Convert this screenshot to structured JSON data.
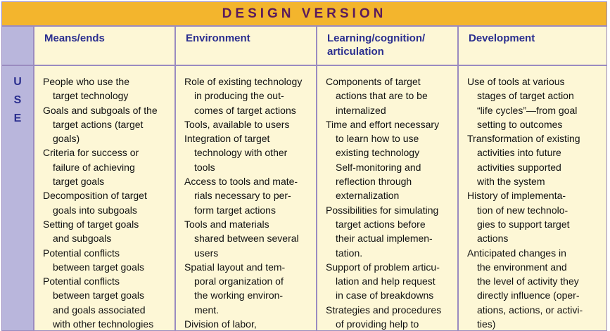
{
  "title": "DESIGN VERSION",
  "side_label": [
    "U",
    "S",
    "E"
  ],
  "columns": [
    {
      "heading": [
        "Means/ends"
      ],
      "lines": [
        {
          "text": "People who use the",
          "indent": false
        },
        {
          "text": "target technology",
          "indent": true
        },
        {
          "text": "Goals and subgoals of the",
          "indent": false
        },
        {
          "text": "target actions (target",
          "indent": true
        },
        {
          "text": "goals)",
          "indent": true
        },
        {
          "text": "Criteria for success or",
          "indent": false
        },
        {
          "text": "failure of achieving",
          "indent": true
        },
        {
          "text": "target goals",
          "indent": true
        },
        {
          "text": "Decomposition of target",
          "indent": false
        },
        {
          "text": "goals into subgoals",
          "indent": true
        },
        {
          "text": "Setting of target goals",
          "indent": false
        },
        {
          "text": "and subgoals",
          "indent": true
        },
        {
          "text": "Potential conflicts",
          "indent": false
        },
        {
          "text": "between target goals",
          "indent": true
        },
        {
          "text": "Potential conflicts",
          "indent": false
        },
        {
          "text": "between target goals",
          "indent": true
        },
        {
          "text": "and goals associated",
          "indent": true
        },
        {
          "text": "with other technologies",
          "indent": true
        }
      ]
    },
    {
      "heading": [
        "Environment"
      ],
      "lines": [
        {
          "text": "Role of existing technology",
          "indent": false
        },
        {
          "text": "in producing the out-",
          "indent": true
        },
        {
          "text": "comes of target actions",
          "indent": true
        },
        {
          "text": "Tools, available to users",
          "indent": false
        },
        {
          "text": "Integration of target",
          "indent": false
        },
        {
          "text": "technology with other",
          "indent": true
        },
        {
          "text": "tools",
          "indent": true
        },
        {
          "text": "Access to tools and mate-",
          "indent": false
        },
        {
          "text": "rials necessary to per-",
          "indent": true
        },
        {
          "text": "form target actions",
          "indent": true
        },
        {
          "text": "Tools and materials",
          "indent": false
        },
        {
          "text": "shared between several",
          "indent": true
        },
        {
          "text": "users",
          "indent": true
        },
        {
          "text": "Spatial layout and tem-",
          "indent": false
        },
        {
          "text": "poral organization of",
          "indent": true
        },
        {
          "text": "the working environ-",
          "indent": true
        },
        {
          "text": "ment.",
          "indent": true
        },
        {
          "text": "Division of labor,",
          "indent": false
        }
      ]
    },
    {
      "heading": [
        "Learning/cognition/",
        "articulation"
      ],
      "lines": [
        {
          "text": "Components of target",
          "indent": false
        },
        {
          "text": "actions that are to be",
          "indent": true
        },
        {
          "text": "internalized",
          "indent": true
        },
        {
          "text": "Time and effort necessary",
          "indent": false
        },
        {
          "text": "to learn how to use",
          "indent": true
        },
        {
          "text": "existing technology",
          "indent": true
        },
        {
          "text": "Self-monitoring and",
          "indent": true
        },
        {
          "text": "reflection through",
          "indent": true
        },
        {
          "text": "externalization",
          "indent": true
        },
        {
          "text": "Possibilities for simulating",
          "indent": false
        },
        {
          "text": "target actions before",
          "indent": true
        },
        {
          "text": "their actual implemen-",
          "indent": true
        },
        {
          "text": "tation.",
          "indent": true
        },
        {
          "text": "Support of problem articu-",
          "indent": false
        },
        {
          "text": "lation and help request",
          "indent": true
        },
        {
          "text": "in case of breakdowns",
          "indent": true
        },
        {
          "text": "Strategies and procedures",
          "indent": false
        },
        {
          "text": "of providing help to",
          "indent": true
        }
      ]
    },
    {
      "heading": [
        "Development"
      ],
      "lines": [
        {
          "text": "Use of tools at various",
          "indent": false
        },
        {
          "text": "stages of target action",
          "indent": true
        },
        {
          "text": "“life cycles”—from goal",
          "indent": true
        },
        {
          "text": "setting to outcomes",
          "indent": true
        },
        {
          "text": "Transformation of existing",
          "indent": false
        },
        {
          "text": "activities into future",
          "indent": true
        },
        {
          "text": "activities supported",
          "indent": true
        },
        {
          "text": "with the system",
          "indent": true
        },
        {
          "text": "History of implementa-",
          "indent": false
        },
        {
          "text": "tion of new technolo-",
          "indent": true
        },
        {
          "text": "gies to support target",
          "indent": true
        },
        {
          "text": "actions",
          "indent": true
        },
        {
          "text": "Anticipated changes in",
          "indent": false
        },
        {
          "text": "the environment and",
          "indent": true
        },
        {
          "text": "the level of activity they",
          "indent": true
        },
        {
          "text": "directly influence (oper-",
          "indent": true
        },
        {
          "text": "ations, actions, or activi-",
          "indent": true
        },
        {
          "text": "ties)",
          "indent": true
        }
      ]
    }
  ],
  "colors": {
    "title_bg": "#f3b52d",
    "title_text": "#5a1a5c",
    "side_bg": "#b9b6dc",
    "cell_bg": "#fdf7d6",
    "heading_text": "#2b2f8f",
    "border": "#9a8bc0"
  }
}
